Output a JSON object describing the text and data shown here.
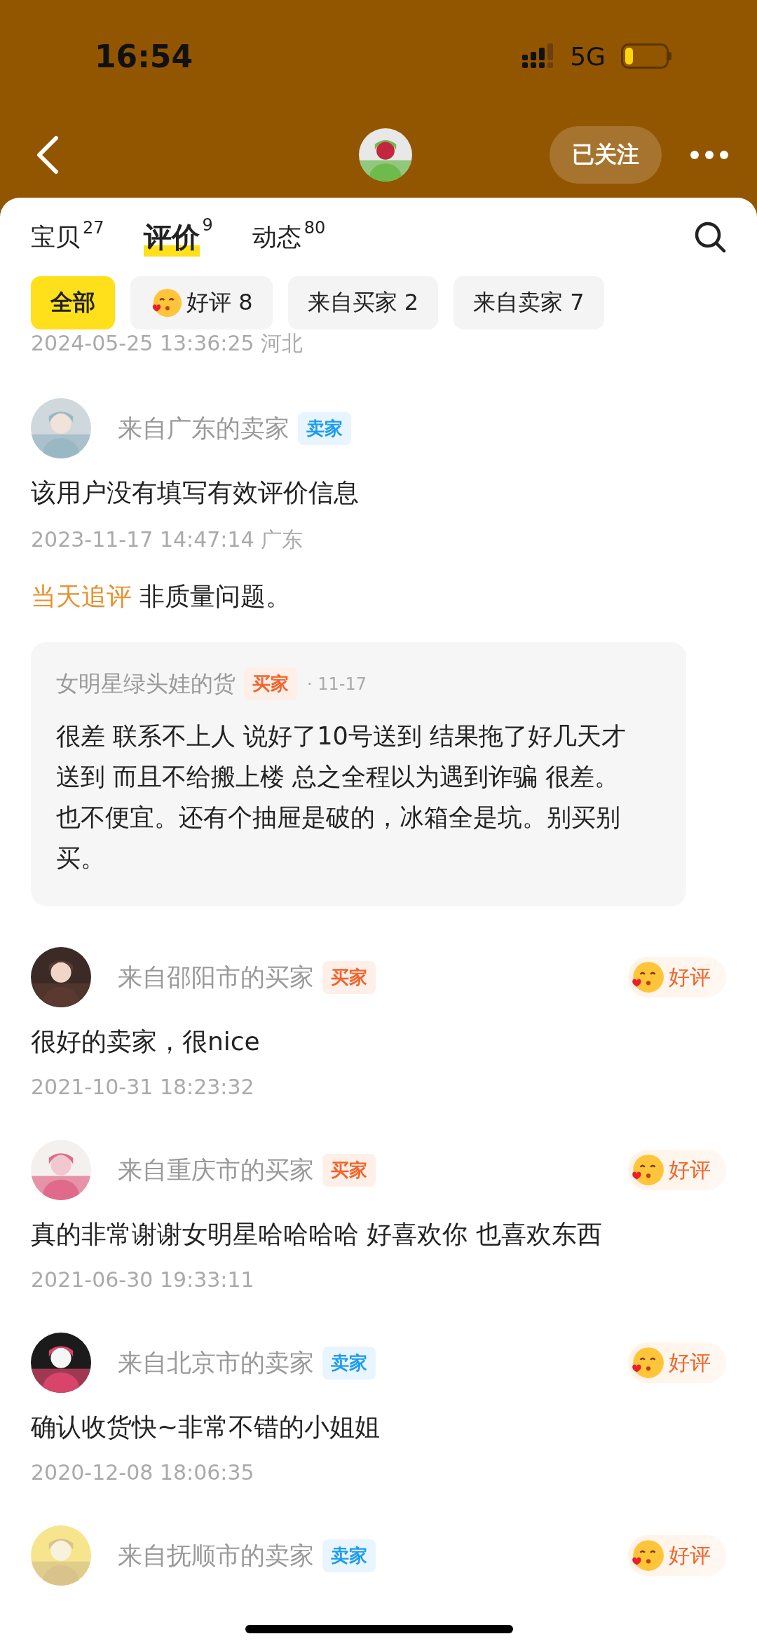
{
  "status_bar": {
    "time": "16:54",
    "network": "5G"
  },
  "header": {
    "follow_button": "已关注"
  },
  "tabs": [
    {
      "label": "宝贝",
      "count": "27",
      "selected": false
    },
    {
      "label": "评价",
      "count": "9",
      "selected": true
    },
    {
      "label": "动态",
      "count": "80",
      "selected": false
    }
  ],
  "filters": [
    {
      "label": "全部",
      "kind": "plain",
      "selected": true
    },
    {
      "label": "好评 8",
      "kind": "rating",
      "selected": false
    },
    {
      "label": "来自买家 2",
      "kind": "plain",
      "selected": false
    },
    {
      "label": "来自卖家 7",
      "kind": "plain",
      "selected": false
    }
  ],
  "partial_date": "2024-05-25 13:36:25 河北",
  "reviews": [
    {
      "name": "来自广东的卖家",
      "badge": "卖家",
      "kind": "seller",
      "text": "该用户没有填写有效评价信息",
      "date": "2023-11-17 14:47:14 广东",
      "followup": {
        "label": "当天追评",
        "text": "非质量问题。"
      },
      "reply": {
        "name": "女明星绿头娃的货",
        "badge": "买家",
        "kind": "buyer",
        "date": "· 11-17",
        "text": "很差 联系不上人 说好了10号送到 结果拖了好几天才送到 而且不给搬上楼 总之全程以为遇到诈骗 很差。也不便宜。还有个抽屉是破的，冰箱全是坑。别买别买。"
      }
    },
    {
      "name": "来自邵阳市的买家",
      "badge": "买家",
      "kind": "buyer",
      "rating": "好评",
      "text": "很好的卖家，很nice",
      "date": "2021-10-31 18:23:32"
    },
    {
      "name": "来自重庆市的买家",
      "badge": "买家",
      "kind": "buyer",
      "rating": "好评",
      "text": "真的非常谢谢女明星哈哈哈哈 好喜欢你 也喜欢东西",
      "date": "2021-06-30 19:33:11"
    },
    {
      "name": "来自北京市的卖家",
      "badge": "卖家",
      "kind": "seller",
      "rating": "好评",
      "text": "确认收货快~非常不错的小姐姐",
      "date": "2020-12-08 18:06:35"
    },
    {
      "name": "来自抚顺市的卖家",
      "badge": "卖家",
      "kind": "seller",
      "rating": "好评"
    }
  ]
}
